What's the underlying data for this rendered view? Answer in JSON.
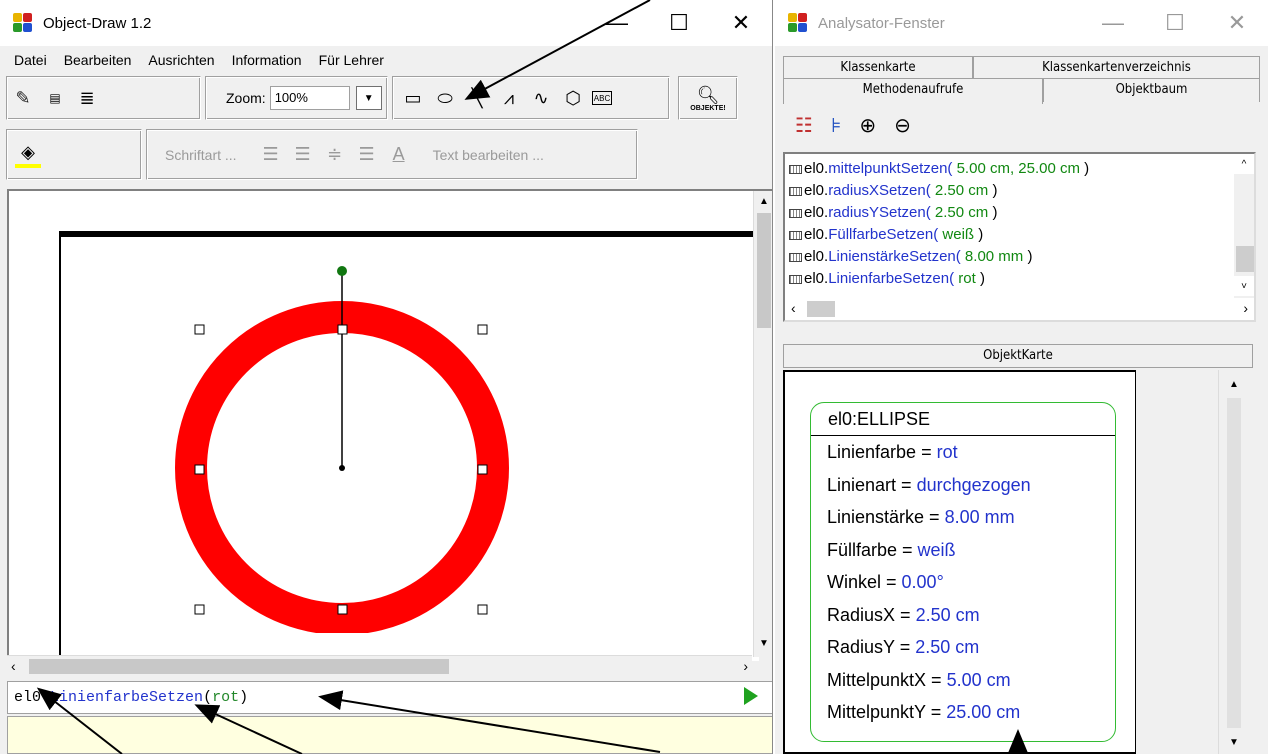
{
  "main_window": {
    "title": "Object-Draw 1.2",
    "buttons": {
      "minimize": "—",
      "maximize": "☐",
      "close": "✕"
    },
    "menu": [
      "Datei",
      "Bearbeiten",
      "Ausrichten",
      "Information",
      "Für Lehrer"
    ],
    "toolbar": {
      "zoom_label": "Zoom:",
      "zoom_value": "100%",
      "objekte_label": "OBJEKTE!",
      "font_button": "Schriftart ...",
      "text_edit_button": "Text bearbeiten ..."
    },
    "command": {
      "object": "el0",
      "dot": ".",
      "method": "LinienfarbeSetzen",
      "open": "(",
      "arg": "rot",
      "close": ")"
    }
  },
  "analysator": {
    "title": "Analysator-Fenster",
    "tabs_top": [
      "Klassenkarte",
      "Klassenkartenverzeichnis"
    ],
    "tabs_bottom": [
      "Methodenaufrufe",
      "Objektbaum"
    ],
    "method_calls": [
      {
        "obj": "el0.",
        "method": "mittelpunktSetzen(",
        "args": " 5.00 cm, 25.00 cm ",
        "end": ")"
      },
      {
        "obj": "el0.",
        "method": "radiusXSetzen(",
        "args": " 2.50 cm ",
        "end": ")"
      },
      {
        "obj": "el0.",
        "method": "radiusYSetzen(",
        "args": " 2.50 cm ",
        "end": ")"
      },
      {
        "obj": "el0.",
        "method": "FüllfarbeSetzen(",
        "args": " weiß ",
        "end": ")"
      },
      {
        "obj": "el0.",
        "method": "LinienstärkeSetzen(",
        "args": " 8.00 mm ",
        "end": ")"
      },
      {
        "obj": "el0.",
        "method": "LinienfarbeSetzen(",
        "args": " rot ",
        "end": ")"
      }
    ],
    "objektkarte_label": "ObjektKarte",
    "card": {
      "header": "el0:ELLIPSE",
      "rows": [
        {
          "key": "Linienfarbe = ",
          "val": "rot"
        },
        {
          "key": "Linienart = ",
          "val": "durchgezogen"
        },
        {
          "key": "Linienstärke = ",
          "val": "8.00 mm"
        },
        {
          "key": "Füllfarbe = ",
          "val": "weiß"
        },
        {
          "key": "Winkel = ",
          "val": "0.00°"
        },
        {
          "key": "RadiusX = ",
          "val": "2.50 cm"
        },
        {
          "key": "RadiusY = ",
          "val": "2.50 cm"
        },
        {
          "key": "MittelpunktX = ",
          "val": "5.00 cm"
        },
        {
          "key": "MittelpunktY = ",
          "val": "25.00 cm"
        }
      ]
    }
  },
  "colors": {
    "ring": "#ff0000",
    "card_border": "#33bb33",
    "value_text": "#2233cc"
  }
}
